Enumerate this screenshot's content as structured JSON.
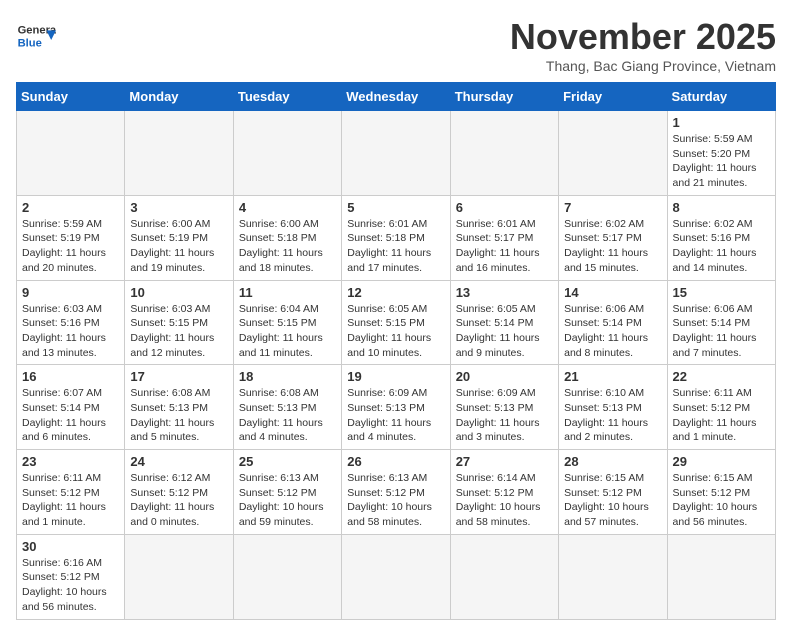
{
  "header": {
    "logo_general": "General",
    "logo_blue": "Blue",
    "month_title": "November 2025",
    "subtitle": "Thang, Bac Giang Province, Vietnam"
  },
  "days_of_week": [
    "Sunday",
    "Monday",
    "Tuesday",
    "Wednesday",
    "Thursday",
    "Friday",
    "Saturday"
  ],
  "weeks": [
    [
      {
        "day": "",
        "info": ""
      },
      {
        "day": "",
        "info": ""
      },
      {
        "day": "",
        "info": ""
      },
      {
        "day": "",
        "info": ""
      },
      {
        "day": "",
        "info": ""
      },
      {
        "day": "",
        "info": ""
      },
      {
        "day": "1",
        "info": "Sunrise: 5:59 AM\nSunset: 5:20 PM\nDaylight: 11 hours and 21 minutes."
      }
    ],
    [
      {
        "day": "2",
        "info": "Sunrise: 5:59 AM\nSunset: 5:19 PM\nDaylight: 11 hours and 20 minutes."
      },
      {
        "day": "3",
        "info": "Sunrise: 6:00 AM\nSunset: 5:19 PM\nDaylight: 11 hours and 19 minutes."
      },
      {
        "day": "4",
        "info": "Sunrise: 6:00 AM\nSunset: 5:18 PM\nDaylight: 11 hours and 18 minutes."
      },
      {
        "day": "5",
        "info": "Sunrise: 6:01 AM\nSunset: 5:18 PM\nDaylight: 11 hours and 17 minutes."
      },
      {
        "day": "6",
        "info": "Sunrise: 6:01 AM\nSunset: 5:17 PM\nDaylight: 11 hours and 16 minutes."
      },
      {
        "day": "7",
        "info": "Sunrise: 6:02 AM\nSunset: 5:17 PM\nDaylight: 11 hours and 15 minutes."
      },
      {
        "day": "8",
        "info": "Sunrise: 6:02 AM\nSunset: 5:16 PM\nDaylight: 11 hours and 14 minutes."
      }
    ],
    [
      {
        "day": "9",
        "info": "Sunrise: 6:03 AM\nSunset: 5:16 PM\nDaylight: 11 hours and 13 minutes."
      },
      {
        "day": "10",
        "info": "Sunrise: 6:03 AM\nSunset: 5:15 PM\nDaylight: 11 hours and 12 minutes."
      },
      {
        "day": "11",
        "info": "Sunrise: 6:04 AM\nSunset: 5:15 PM\nDaylight: 11 hours and 11 minutes."
      },
      {
        "day": "12",
        "info": "Sunrise: 6:05 AM\nSunset: 5:15 PM\nDaylight: 11 hours and 10 minutes."
      },
      {
        "day": "13",
        "info": "Sunrise: 6:05 AM\nSunset: 5:14 PM\nDaylight: 11 hours and 9 minutes."
      },
      {
        "day": "14",
        "info": "Sunrise: 6:06 AM\nSunset: 5:14 PM\nDaylight: 11 hours and 8 minutes."
      },
      {
        "day": "15",
        "info": "Sunrise: 6:06 AM\nSunset: 5:14 PM\nDaylight: 11 hours and 7 minutes."
      }
    ],
    [
      {
        "day": "16",
        "info": "Sunrise: 6:07 AM\nSunset: 5:14 PM\nDaylight: 11 hours and 6 minutes."
      },
      {
        "day": "17",
        "info": "Sunrise: 6:08 AM\nSunset: 5:13 PM\nDaylight: 11 hours and 5 minutes."
      },
      {
        "day": "18",
        "info": "Sunrise: 6:08 AM\nSunset: 5:13 PM\nDaylight: 11 hours and 4 minutes."
      },
      {
        "day": "19",
        "info": "Sunrise: 6:09 AM\nSunset: 5:13 PM\nDaylight: 11 hours and 4 minutes."
      },
      {
        "day": "20",
        "info": "Sunrise: 6:09 AM\nSunset: 5:13 PM\nDaylight: 11 hours and 3 minutes."
      },
      {
        "day": "21",
        "info": "Sunrise: 6:10 AM\nSunset: 5:13 PM\nDaylight: 11 hours and 2 minutes."
      },
      {
        "day": "22",
        "info": "Sunrise: 6:11 AM\nSunset: 5:12 PM\nDaylight: 11 hours and 1 minute."
      }
    ],
    [
      {
        "day": "23",
        "info": "Sunrise: 6:11 AM\nSunset: 5:12 PM\nDaylight: 11 hours and 1 minute."
      },
      {
        "day": "24",
        "info": "Sunrise: 6:12 AM\nSunset: 5:12 PM\nDaylight: 11 hours and 0 minutes."
      },
      {
        "day": "25",
        "info": "Sunrise: 6:13 AM\nSunset: 5:12 PM\nDaylight: 10 hours and 59 minutes."
      },
      {
        "day": "26",
        "info": "Sunrise: 6:13 AM\nSunset: 5:12 PM\nDaylight: 10 hours and 58 minutes."
      },
      {
        "day": "27",
        "info": "Sunrise: 6:14 AM\nSunset: 5:12 PM\nDaylight: 10 hours and 58 minutes."
      },
      {
        "day": "28",
        "info": "Sunrise: 6:15 AM\nSunset: 5:12 PM\nDaylight: 10 hours and 57 minutes."
      },
      {
        "day": "29",
        "info": "Sunrise: 6:15 AM\nSunset: 5:12 PM\nDaylight: 10 hours and 56 minutes."
      }
    ],
    [
      {
        "day": "30",
        "info": "Sunrise: 6:16 AM\nSunset: 5:12 PM\nDaylight: 10 hours and 56 minutes."
      },
      {
        "day": "",
        "info": ""
      },
      {
        "day": "",
        "info": ""
      },
      {
        "day": "",
        "info": ""
      },
      {
        "day": "",
        "info": ""
      },
      {
        "day": "",
        "info": ""
      },
      {
        "day": "",
        "info": ""
      }
    ]
  ]
}
